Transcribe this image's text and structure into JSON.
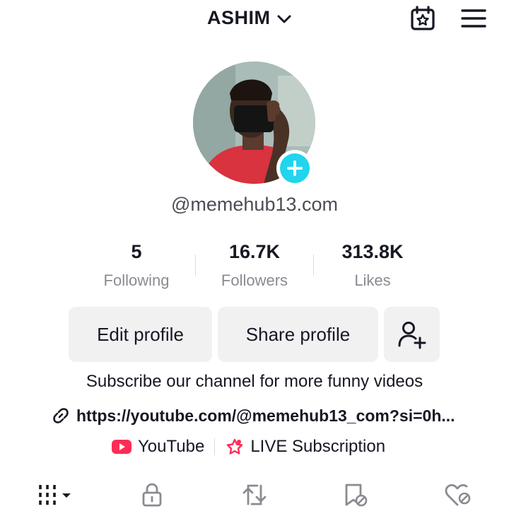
{
  "header": {
    "username": "ASHIM"
  },
  "profile": {
    "handle": "@memehub13.com"
  },
  "stats": [
    {
      "value": "5",
      "label": "Following"
    },
    {
      "value": "16.7K",
      "label": "Followers"
    },
    {
      "value": "313.8K",
      "label": "Likes"
    }
  ],
  "actions": {
    "edit_label": "Edit profile",
    "share_label": "Share profile"
  },
  "bio": {
    "text": "Subscribe our channel for more funny videos",
    "link": "https://youtube.com/@memehub13_com?si=0h..."
  },
  "chips": {
    "youtube_label": "YouTube",
    "live_label": "LIVE Subscription"
  },
  "tabs": [
    {
      "icon": "grid-icon"
    },
    {
      "icon": "lock-icon"
    },
    {
      "icon": "repost-icon"
    },
    {
      "icon": "bookmark-icon"
    },
    {
      "icon": "liked-heart-icon"
    }
  ],
  "colors": {
    "accent": "#20d5ec",
    "youtube_red": "#fe2c55",
    "text": "#161823",
    "muted": "#8a8b91",
    "button_bg": "#f1f1f2"
  }
}
